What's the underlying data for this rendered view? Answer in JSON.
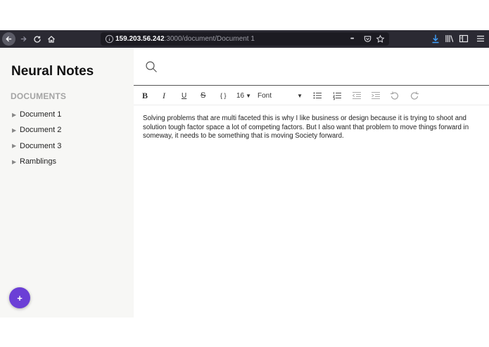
{
  "browser": {
    "url_host": "159.203.56.242",
    "url_rest": ":3000/document/Document 1",
    "overflow_glyph": "•••"
  },
  "sidebar": {
    "title": "Neural Notes",
    "section_heading": "DOCUMENTS",
    "documents": [
      "Document 1",
      "Document 2",
      "Document 3",
      "Ramblings"
    ],
    "add_button_label": "+"
  },
  "editor": {
    "toolbar": {
      "bold": "B",
      "italic": "I",
      "underline": "U",
      "strikethrough": "S",
      "code": "{ }",
      "font_size": "16",
      "font_family": "Font"
    },
    "body": "Solving problems that are multi faceted this is why I like business or design because it is trying to shoot and solution tough factor space a lot of competing factors. But I also want that problem to move things forward in someway, it needs to be something that is moving Society forward."
  },
  "colors": {
    "chrome": "#2b2a33",
    "urlbar": "#1c1b22",
    "sidebar_bg": "#f7f7f5",
    "accent": "#6b3fd6",
    "download": "#3fa1ff"
  }
}
